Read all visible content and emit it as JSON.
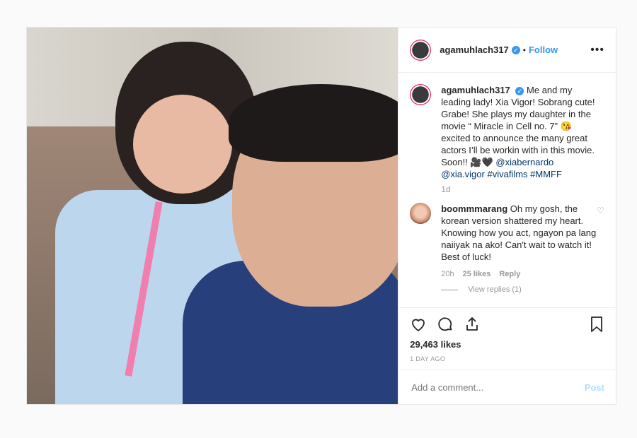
{
  "header": {
    "username": "agamuhlach317",
    "separator": "•",
    "follow_label": "Follow",
    "more_label": "•••"
  },
  "caption": {
    "username": "agamuhlach317",
    "text": "Me and my leading lady! Xia Vigor! Sobrang cute! Grabe! She plays my daughter in the movie “ Miracle in Cell no. 7” 😘 excited to announce the many great actors I’ll be workin with in this movie. Soon!! 🎥🖤 ",
    "mentions": "@xiabernardo @xia.vigor",
    "hashtags": "#vivafilms #MMFF",
    "time": "1d"
  },
  "comment": {
    "username": "boommmarang",
    "text": "Oh my gosh, the korean version shattered my heart. Knowing how you act, ngayon pa lang naiiyak na ako! Can't wait to watch it! Best of luck!",
    "time": "20h",
    "likes": "25 likes",
    "reply_label": "Reply",
    "view_replies": "View replies (1)"
  },
  "actions": {
    "likes": "29,463 likes",
    "ago": "1 DAY AGO"
  },
  "add_comment": {
    "placeholder": "Add a comment...",
    "post_label": "Post"
  },
  "colors": {
    "accent": "#3897f0",
    "verified": "#3897f0",
    "mention": "#003569",
    "muted": "#999999",
    "post_disabled": "#b3dbff"
  }
}
